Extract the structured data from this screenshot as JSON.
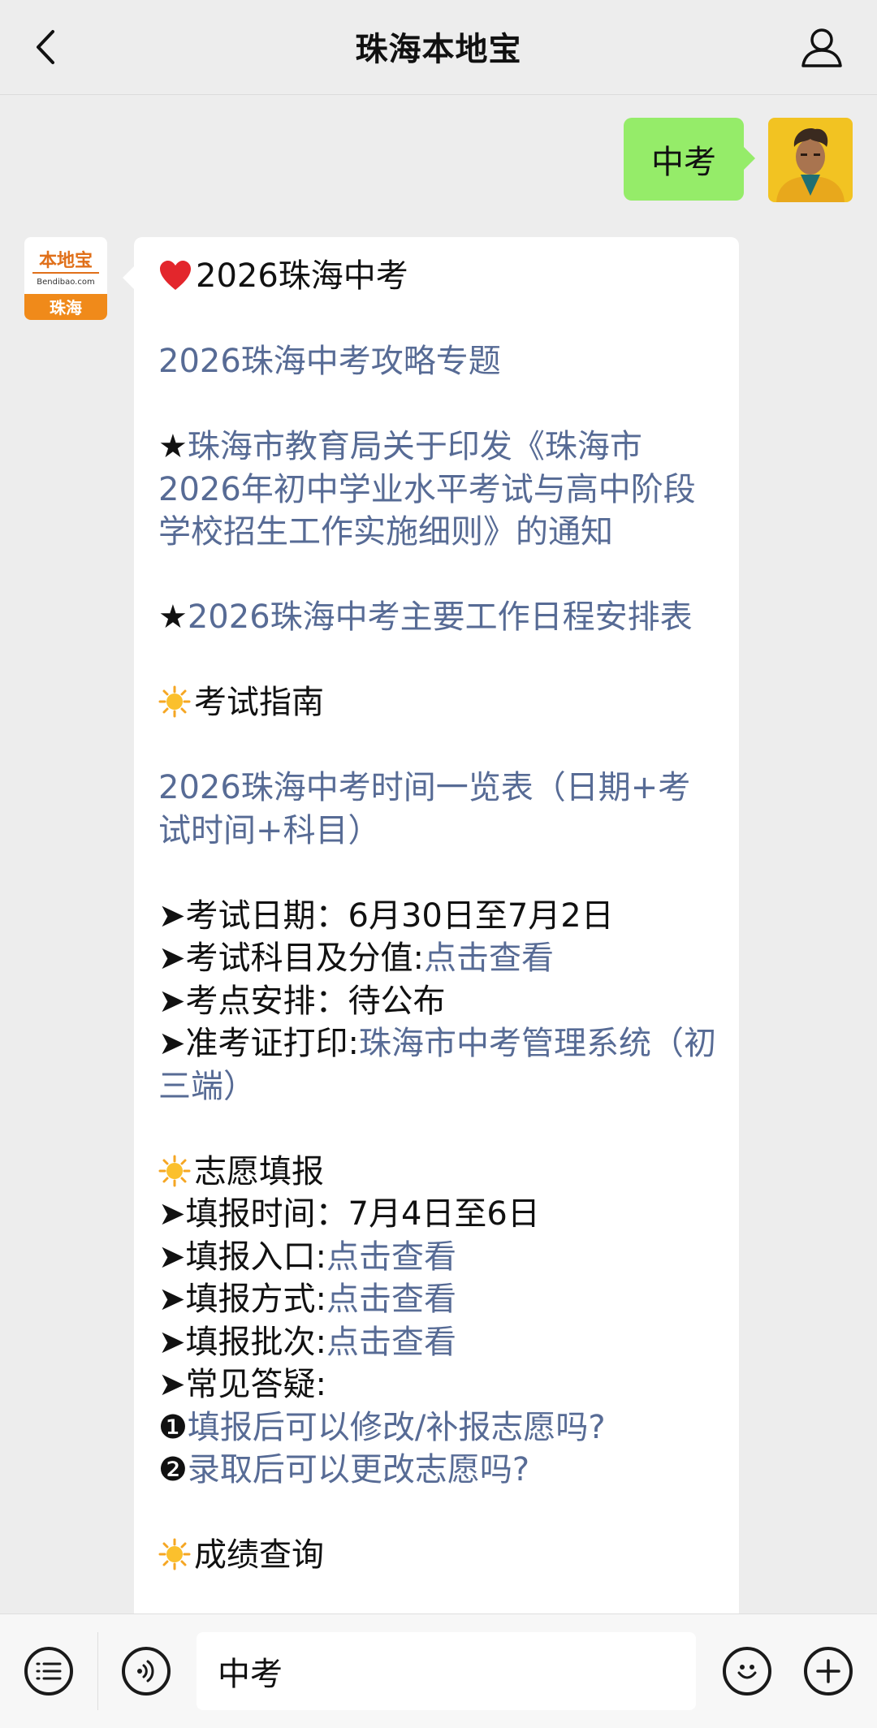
{
  "header": {
    "title": "珠海本地宝"
  },
  "avatars": {
    "brand_logo_top": "本地宝",
    "brand_logo_url": "Bendibao.com",
    "brand_logo_city": "珠海"
  },
  "outgoing": {
    "text": "中考"
  },
  "message": {
    "title": "2026珠海中考",
    "topic_link": "2026珠海中考攻略专题",
    "notice_star": "★",
    "notice_link": "珠海市教育局关于印发《珠海市2026年初中学业水平考试与高中阶段学校招生工作实施细则》的通知",
    "schedule_link": "2026珠海中考主要工作日程安排表",
    "section_exam": "考试指南",
    "exam_table_link": "2026珠海中考时间一览表（日期+考试时间+科目）",
    "exam_items": [
      {
        "label": "➤考试日期：",
        "value": "6月30日至7月2日",
        "is_link": false
      },
      {
        "label": "➤考试科目及分值:",
        "value": "点击查看",
        "is_link": true
      },
      {
        "label": "➤考点安排：",
        "value": "待公布",
        "is_link": false
      }
    ],
    "admit_label": "➤准考证打印:",
    "admit_link": "珠海市中考管理系统（初三端）",
    "section_volunteer": "志愿填报",
    "volunteer_items": [
      {
        "label": "➤填报时间：",
        "value": "7月4日至6日",
        "is_link": false
      },
      {
        "label": "➤填报入口:",
        "value": "点击查看",
        "is_link": true
      },
      {
        "label": "➤填报方式:",
        "value": "点击查看",
        "is_link": true
      },
      {
        "label": "➤填报批次:",
        "value": "点击查看",
        "is_link": true
      },
      {
        "label": "➤常见答疑:",
        "value": "",
        "is_link": false
      }
    ],
    "faq": [
      {
        "num": "❶",
        "text": "填报后可以修改/补报志愿吗?"
      },
      {
        "num": "❷",
        "text": "录取后可以更改志愿吗?"
      }
    ],
    "section_score": "成绩查询"
  },
  "composer": {
    "input_value": "中考"
  },
  "colors": {
    "link": "#576b95",
    "bubble_out": "#95ec69",
    "brand": "#f08a1a"
  }
}
